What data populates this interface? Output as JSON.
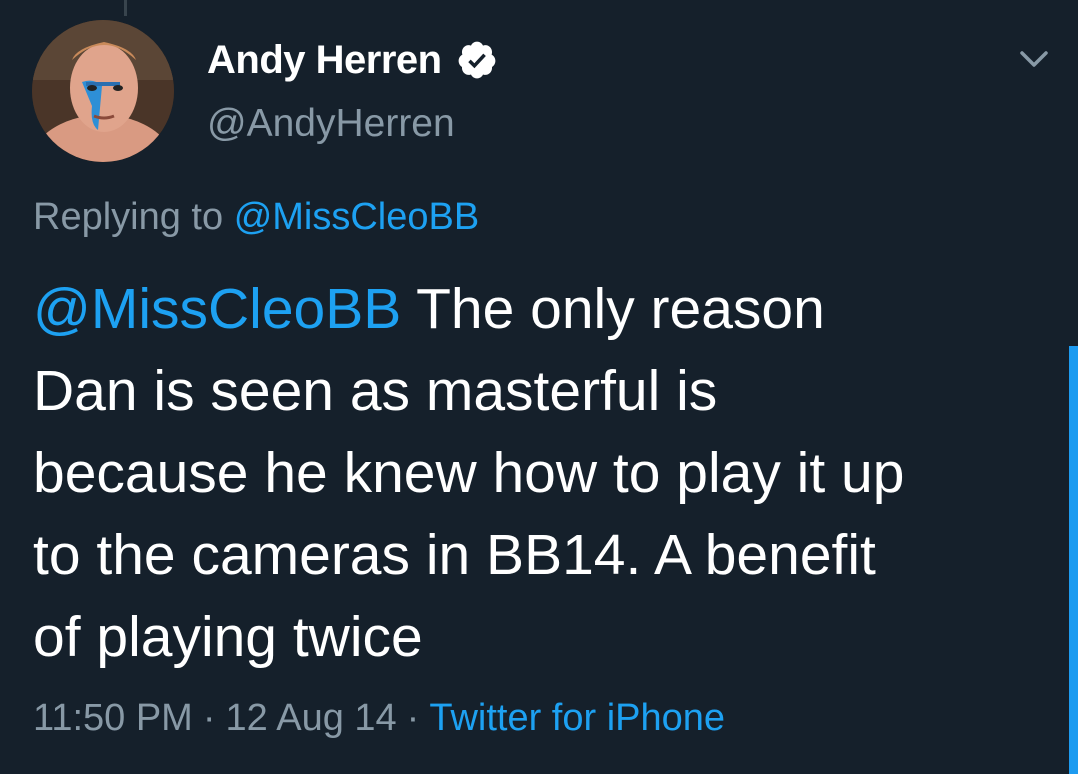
{
  "author": {
    "display_name": "Andy Herren",
    "handle": "@AndyHerren",
    "verified": true
  },
  "reply_context": {
    "prefix": "Replying to",
    "target": "@MissCleoBB"
  },
  "tweet": {
    "mention": "@MissCleoBB",
    "lines": [
      "The only reason",
      "Dan is seen as masterful is",
      "because he knew how to play it up",
      "to the cameras in BB14. A benefit",
      "of playing twice"
    ]
  },
  "meta": {
    "time": "11:50 PM",
    "separator": "·",
    "date": "12 Aug 14",
    "source": "Twitter for iPhone"
  },
  "icons": {
    "verified": "verified-badge-icon",
    "menu": "chevron-down-icon"
  },
  "colors": {
    "background": "#15202b",
    "accent": "#1da1f2",
    "secondary_text": "#8899a6",
    "primary_text": "#ffffff"
  }
}
